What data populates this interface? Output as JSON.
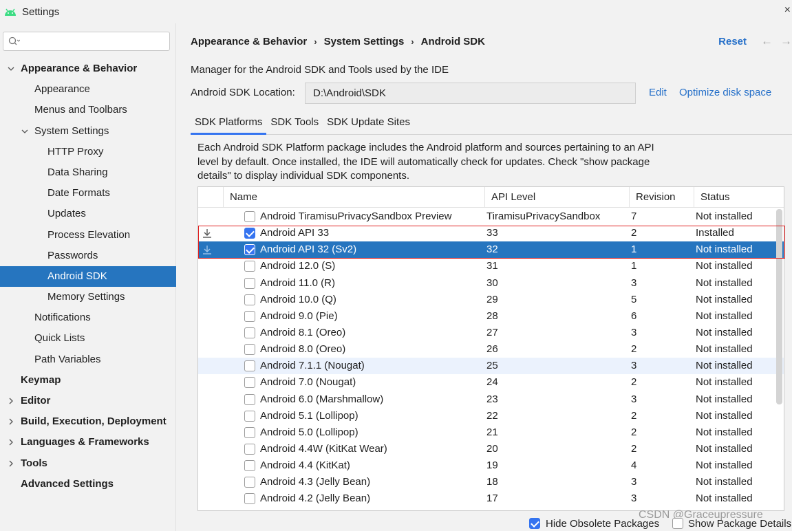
{
  "window": {
    "title": "Settings",
    "close_glyph": "×",
    "icon": "android-icon"
  },
  "sidebar": {
    "search_placeholder": "",
    "items": [
      {
        "label": "Appearance & Behavior",
        "level": 0,
        "bold": true,
        "expanded": true
      },
      {
        "label": "Appearance",
        "level": 1
      },
      {
        "label": "Menus and Toolbars",
        "level": 1
      },
      {
        "label": "System Settings",
        "level": 1,
        "expanded": true
      },
      {
        "label": "HTTP Proxy",
        "level": 2
      },
      {
        "label": "Data Sharing",
        "level": 2
      },
      {
        "label": "Date Formats",
        "level": 2
      },
      {
        "label": "Updates",
        "level": 2
      },
      {
        "label": "Process Elevation",
        "level": 2
      },
      {
        "label": "Passwords",
        "level": 2
      },
      {
        "label": "Android SDK",
        "level": 2,
        "selected": true
      },
      {
        "label": "Memory Settings",
        "level": 2
      },
      {
        "label": "Notifications",
        "level": 1
      },
      {
        "label": "Quick Lists",
        "level": 1
      },
      {
        "label": "Path Variables",
        "level": 1
      },
      {
        "label": "Keymap",
        "level": 0,
        "bold": true
      },
      {
        "label": "Editor",
        "level": 0,
        "bold": true,
        "collapsed": true
      },
      {
        "label": "Build, Execution, Deployment",
        "level": 0,
        "bold": true,
        "collapsed": true
      },
      {
        "label": "Languages & Frameworks",
        "level": 0,
        "bold": true,
        "collapsed": true
      },
      {
        "label": "Tools",
        "level": 0,
        "bold": true,
        "collapsed": true
      },
      {
        "label": "Advanced Settings",
        "level": 0,
        "bold": true
      }
    ]
  },
  "header": {
    "breadcrumb": [
      "Appearance & Behavior",
      "System Settings",
      "Android SDK"
    ],
    "breadcrumb_sep": "›",
    "reset": "Reset",
    "back_glyph": "←",
    "forward_glyph": "→"
  },
  "main": {
    "description": "Manager for the Android SDK and Tools used by the IDE",
    "location_label": "Android SDK Location:",
    "location_value": "D:\\Android\\SDK",
    "edit_link": "Edit",
    "optimize_link": "Optimize disk space",
    "tabs": [
      {
        "label": "SDK Platforms",
        "active": true
      },
      {
        "label": "SDK Tools"
      },
      {
        "label": "SDK Update Sites"
      }
    ],
    "info_lines": [
      "Each Android SDK Platform package includes the Android platform and sources pertaining to an API",
      "level by default. Once installed, the IDE will automatically check for updates. Check \"show package",
      "details\" to display individual SDK components."
    ]
  },
  "table": {
    "columns": [
      "Name",
      "API Level",
      "Revision",
      "Status"
    ],
    "rows": [
      {
        "name": "Android TiramisuPrivacySandbox Preview",
        "api": "TiramisuPrivacySandbox",
        "rev": "7",
        "status": "Not installed",
        "checked": false
      },
      {
        "name": "Android API 33",
        "api": "33",
        "rev": "2",
        "status": "Installed",
        "checked": true,
        "download": true
      },
      {
        "name": "Android API 32 (Sv2)",
        "api": "32",
        "rev": "1",
        "status": "Not installed",
        "checked": true,
        "download": true,
        "selected": true
      },
      {
        "name": "Android 12.0 (S)",
        "api": "31",
        "rev": "1",
        "status": "Not installed",
        "checked": false
      },
      {
        "name": "Android 11.0 (R)",
        "api": "30",
        "rev": "3",
        "status": "Not installed",
        "checked": false
      },
      {
        "name": "Android 10.0 (Q)",
        "api": "29",
        "rev": "5",
        "status": "Not installed",
        "checked": false
      },
      {
        "name": "Android 9.0 (Pie)",
        "api": "28",
        "rev": "6",
        "status": "Not installed",
        "checked": false
      },
      {
        "name": "Android 8.1 (Oreo)",
        "api": "27",
        "rev": "3",
        "status": "Not installed",
        "checked": false
      },
      {
        "name": "Android 8.0 (Oreo)",
        "api": "26",
        "rev": "2",
        "status": "Not installed",
        "checked": false
      },
      {
        "name": "Android 7.1.1 (Nougat)",
        "api": "25",
        "rev": "3",
        "status": "Not installed",
        "checked": false,
        "hover": true
      },
      {
        "name": "Android 7.0 (Nougat)",
        "api": "24",
        "rev": "2",
        "status": "Not installed",
        "checked": false
      },
      {
        "name": "Android 6.0 (Marshmallow)",
        "api": "23",
        "rev": "3",
        "status": "Not installed",
        "checked": false
      },
      {
        "name": "Android 5.1 (Lollipop)",
        "api": "22",
        "rev": "2",
        "status": "Not installed",
        "checked": false
      },
      {
        "name": "Android 5.0 (Lollipop)",
        "api": "21",
        "rev": "2",
        "status": "Not installed",
        "checked": false
      },
      {
        "name": "Android 4.4W (KitKat Wear)",
        "api": "20",
        "rev": "2",
        "status": "Not installed",
        "checked": false
      },
      {
        "name": "Android 4.4 (KitKat)",
        "api": "19",
        "rev": "4",
        "status": "Not installed",
        "checked": false
      },
      {
        "name": "Android 4.3 (Jelly Bean)",
        "api": "18",
        "rev": "3",
        "status": "Not installed",
        "checked": false
      },
      {
        "name": "Android 4.2 (Jelly Bean)",
        "api": "17",
        "rev": "3",
        "status": "Not installed",
        "checked": false
      }
    ]
  },
  "footer": {
    "hide_obsolete": {
      "label": "Hide Obsolete Packages",
      "checked": true
    },
    "show_details": {
      "label": "Show Package Details",
      "checked": false
    },
    "watermark": "CSDN @Graceupressure"
  },
  "colors": {
    "accent": "#3574f0",
    "selection": "#2675bf",
    "link": "#2670c9",
    "highlight_box": "#e02020"
  }
}
